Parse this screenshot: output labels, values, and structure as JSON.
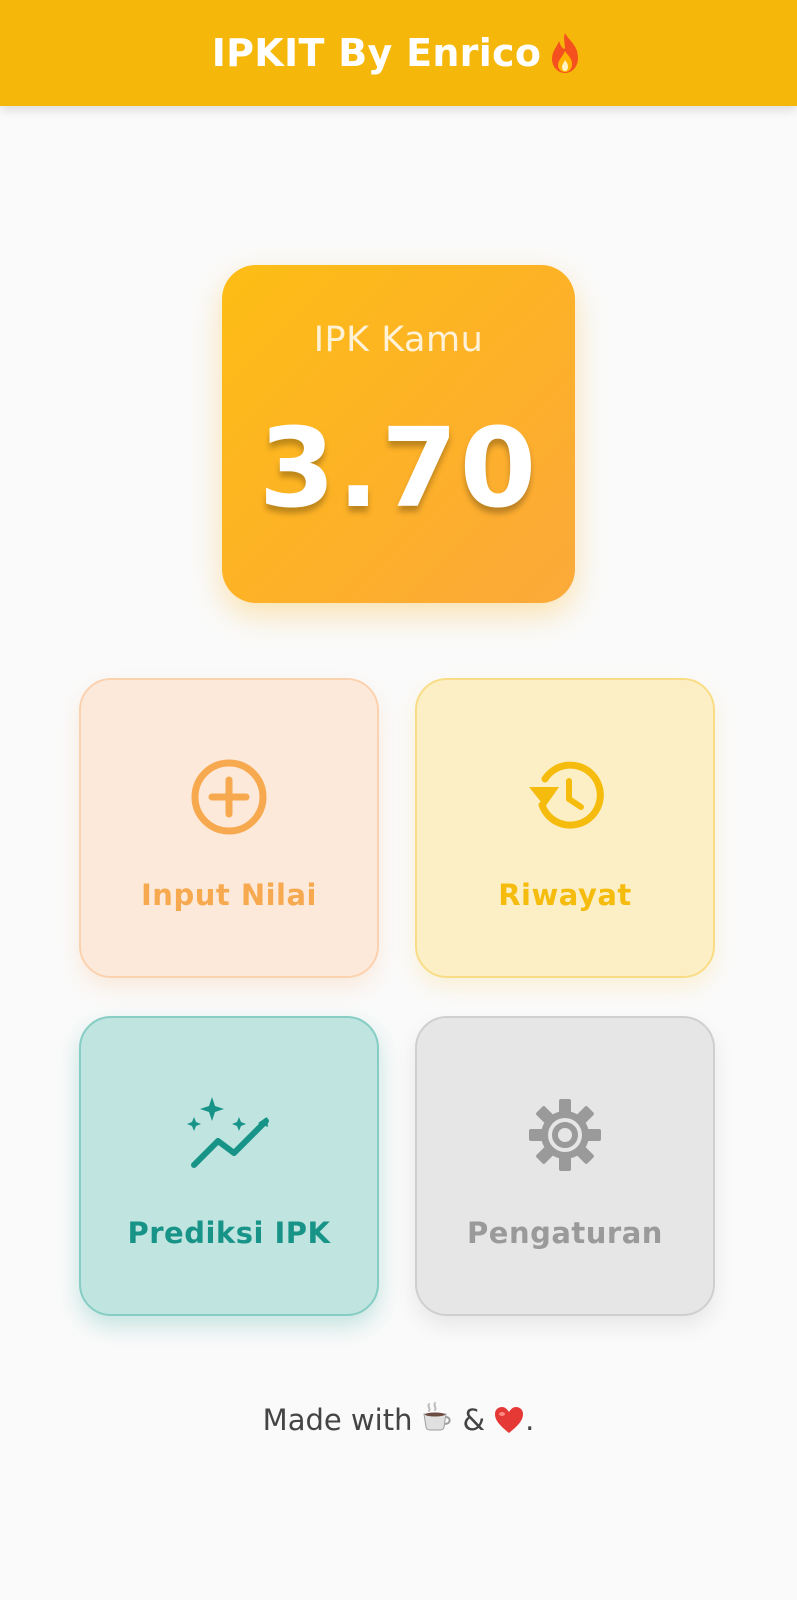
{
  "appbar": {
    "title": "IPKIT By Enrico",
    "title_icon": "fire-icon"
  },
  "ipk_card": {
    "label": "IPK Kamu",
    "value": "3.70"
  },
  "menu": [
    {
      "label": "Input Nilai",
      "icon": "add-circle-icon",
      "color": "#f7a94f"
    },
    {
      "label": "Riwayat",
      "icon": "history-icon",
      "color": "#f5bc0d"
    },
    {
      "label": "Prediksi IPK",
      "icon": "trending-sparkle-icon",
      "color": "#189387"
    },
    {
      "label": "Pengaturan",
      "icon": "gear-icon",
      "color": "#9a9a9a"
    }
  ],
  "footer": {
    "text_before": "Made with",
    "amp": "&",
    "period": ".",
    "icons": [
      "coffee-icon",
      "heart-icon"
    ]
  },
  "colors": {
    "appbar": "#f4b70a",
    "background": "#fafafa"
  }
}
